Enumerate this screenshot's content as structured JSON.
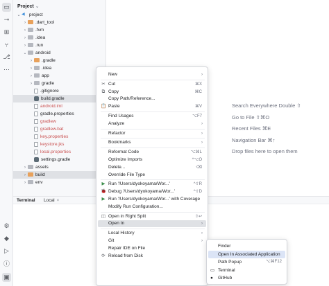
{
  "project_panel": {
    "title": "Project",
    "title_chevron": "⌄",
    "tree": [
      {
        "label": "project",
        "arrow": "⌄",
        "icon": "project-icon",
        "indent": 0,
        "style": "normal"
      },
      {
        "label": ".dart_tool",
        "arrow": "›",
        "icon": "orange",
        "indent": 1,
        "style": "normal"
      },
      {
        "label": ".fvm",
        "arrow": "›",
        "icon": "folder",
        "indent": 1,
        "style": "normal"
      },
      {
        "label": ".idea",
        "arrow": "›",
        "icon": "folder",
        "indent": 1,
        "style": "normal"
      },
      {
        "label": ".run",
        "arrow": "›",
        "icon": "folder",
        "indent": 1,
        "style": "normal"
      },
      {
        "label": "android",
        "arrow": "⌄",
        "icon": "folder",
        "indent": 1,
        "style": "normal"
      },
      {
        "label": ".gradle",
        "arrow": "›",
        "icon": "orange",
        "indent": 2,
        "style": "normal"
      },
      {
        "label": ".idea",
        "arrow": "›",
        "icon": "folder",
        "indent": 2,
        "style": "normal"
      },
      {
        "label": "app",
        "arrow": "›",
        "icon": "folder",
        "indent": 2,
        "style": "normal"
      },
      {
        "label": "gradle",
        "arrow": "›",
        "icon": "folder",
        "indent": 2,
        "style": "normal"
      },
      {
        "label": ".gitignore",
        "arrow": "",
        "icon": "file",
        "indent": 2,
        "style": "normal"
      },
      {
        "label": "build.gradle",
        "arrow": "",
        "icon": "gradle",
        "indent": 2,
        "style": "normal",
        "selected": true
      },
      {
        "label": "android.iml",
        "arrow": "",
        "icon": "file",
        "indent": 2,
        "style": "red"
      },
      {
        "label": "gradle.properties",
        "arrow": "",
        "icon": "file",
        "indent": 2,
        "style": "normal"
      },
      {
        "label": "gradlew",
        "arrow": "",
        "icon": "file",
        "indent": 2,
        "style": "red"
      },
      {
        "label": "gradlew.bat",
        "arrow": "",
        "icon": "file",
        "indent": 2,
        "style": "red"
      },
      {
        "label": "key.properties",
        "arrow": "",
        "icon": "file",
        "indent": 2,
        "style": "red"
      },
      {
        "label": "keystore.jks",
        "arrow": "",
        "icon": "file",
        "indent": 2,
        "style": "red"
      },
      {
        "label": "local.properties",
        "arrow": "",
        "icon": "file",
        "indent": 2,
        "style": "red"
      },
      {
        "label": "settings.gradle",
        "arrow": "",
        "icon": "gradle",
        "indent": 2,
        "style": "normal"
      },
      {
        "label": "assets",
        "arrow": "›",
        "icon": "folder",
        "indent": 1,
        "style": "normal"
      },
      {
        "label": "build",
        "arrow": "›",
        "icon": "orange",
        "indent": 1,
        "style": "normal",
        "selected": true
      },
      {
        "label": "env",
        "arrow": "›",
        "icon": "folder",
        "indent": 1,
        "style": "normal"
      }
    ]
  },
  "editor_hints": [
    {
      "label": "Search Everywhere",
      "shortcut": "Double ⇧"
    },
    {
      "label": "Go to File",
      "shortcut": "⇧⌘O"
    },
    {
      "label": "Recent Files",
      "shortcut": "⌘E"
    },
    {
      "label": "Navigation Bar",
      "shortcut": "⌘↑"
    },
    {
      "label": "Drop files here to open them",
      "shortcut": ""
    }
  ],
  "terminal": {
    "title": "Terminal",
    "tab_label": "Local",
    "tab_close": "×"
  },
  "context_menu": {
    "items": [
      {
        "label": "New",
        "icon": "",
        "shortcut": "",
        "submenu": true
      },
      {
        "sep": true
      },
      {
        "label": "Cut",
        "icon": "✂",
        "shortcut": "⌘X"
      },
      {
        "label": "Copy",
        "icon": "⧉",
        "shortcut": "⌘C"
      },
      {
        "label": "Copy Path/Reference...",
        "icon": "",
        "shortcut": ""
      },
      {
        "label": "Paste",
        "icon": "📋",
        "shortcut": "⌘V"
      },
      {
        "sep": true
      },
      {
        "label": "Find Usages",
        "icon": "",
        "shortcut": "⌥F7"
      },
      {
        "label": "Analyze",
        "icon": "",
        "shortcut": "",
        "submenu": true
      },
      {
        "sep": true
      },
      {
        "label": "Refactor",
        "icon": "",
        "shortcut": "",
        "submenu": true
      },
      {
        "sep": true
      },
      {
        "label": "Bookmarks",
        "icon": "",
        "shortcut": "",
        "submenu": true
      },
      {
        "sep": true
      },
      {
        "label": "Reformat Code",
        "icon": "",
        "shortcut": "⌥⌘L"
      },
      {
        "label": "Optimize Imports",
        "icon": "",
        "shortcut": "^⌥O"
      },
      {
        "label": "Delete...",
        "icon": "",
        "shortcut": "⌫"
      },
      {
        "label": "Override File Type",
        "icon": "",
        "shortcut": ""
      },
      {
        "sep": true
      },
      {
        "label": "Run '/Users/dyokoyama/Wor...'",
        "icon": "▶",
        "icon_color": "green",
        "shortcut": "^⇧R"
      },
      {
        "label": "Debug '/Users/dyokoyama/Wor...'",
        "icon": "🐞",
        "icon_color": "green",
        "shortcut": "^⇧D"
      },
      {
        "label": "Run '/Users/dyokoyama/Wor...' with Coverage",
        "icon": "▶",
        "icon_color": "green",
        "shortcut": ""
      },
      {
        "label": "Modify Run Configuration...",
        "icon": "",
        "shortcut": ""
      },
      {
        "sep": true
      },
      {
        "label": "Open in Right Split",
        "icon": "◫",
        "shortcut": "⇧↩"
      },
      {
        "label": "Open In",
        "icon": "",
        "shortcut": "",
        "submenu": true,
        "highlighted": true
      },
      {
        "sep": true
      },
      {
        "label": "Local History",
        "icon": "",
        "shortcut": "",
        "submenu": true
      },
      {
        "label": "Git",
        "icon": "",
        "shortcut": "",
        "submenu": true
      },
      {
        "label": "Repair IDE on File",
        "icon": "",
        "shortcut": ""
      },
      {
        "label": "Reload from Disk",
        "icon": "⟳",
        "shortcut": ""
      }
    ]
  },
  "open_in_submenu": {
    "items": [
      {
        "label": "Finder",
        "icon": "",
        "shortcut": ""
      },
      {
        "label": "Open In Associated Application",
        "icon": "",
        "shortcut": "",
        "highlighted": true
      },
      {
        "label": "Path Popup",
        "icon": "",
        "shortcut": "⌥⌘F12"
      },
      {
        "label": "Terminal",
        "icon": "▭",
        "shortcut": ""
      },
      {
        "label": "GitHub",
        "icon": "●",
        "shortcut": ""
      }
    ]
  },
  "colors": {
    "accent": "#dbe4f6",
    "selection": "#dfe1e5",
    "error_text": "#c94f4f",
    "run_icon": "#3e8f4d"
  }
}
